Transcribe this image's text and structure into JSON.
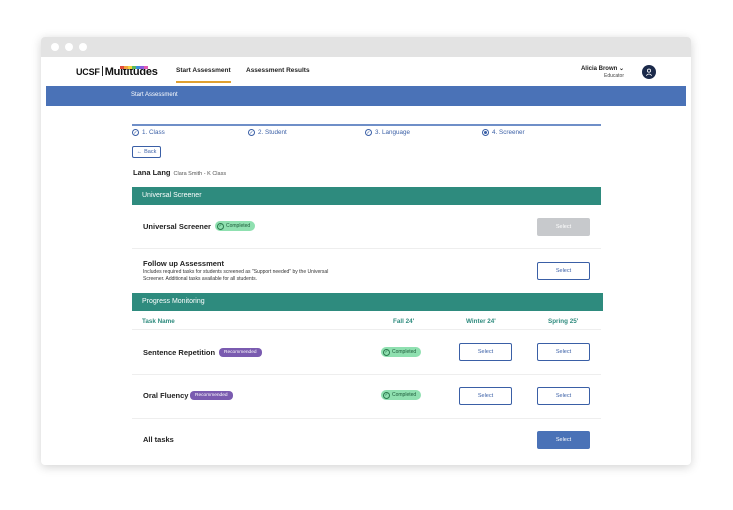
{
  "header": {
    "logo_prefix": "UCSF",
    "logo_name": "Multitudes",
    "tabs": [
      {
        "label": "Start Assessment",
        "active": true
      },
      {
        "label": "Assessment Results",
        "active": false
      }
    ],
    "user": {
      "name": "Alicia Brown",
      "role": "Educator",
      "icon": "user-icon"
    }
  },
  "banner": {
    "title": "Start Assessment"
  },
  "stepper": {
    "steps": [
      {
        "label": "1. Class",
        "state": "done"
      },
      {
        "label": "2. Student",
        "state": "done"
      },
      {
        "label": "3. Language",
        "state": "done"
      },
      {
        "label": "4. Screener",
        "state": "current"
      }
    ]
  },
  "back_label": "Back",
  "student": {
    "name": "Lana Lang",
    "class": "Clara Smith - K Class"
  },
  "universal": {
    "section_title": "Universal Screener",
    "row_title": "Universal Screener",
    "status": "Completed",
    "select_label": "Select"
  },
  "followup": {
    "title": "Follow up Assessment",
    "description": "Includes required tasks for students screened as \"Support needed\" by the Universal Screener. Additional tasks available for all students.",
    "select_label": "Select"
  },
  "progress": {
    "section_title": "Progress Monitoring",
    "columns": [
      "Task Name",
      "Fall 24'",
      "Winter 24'",
      "Spring 25'"
    ],
    "rows": [
      {
        "name": "Sentence Repetition",
        "tag": "Recommended",
        "fall": "Completed",
        "winter": "Select",
        "spring": "Select"
      },
      {
        "name": "Oral Fluency",
        "tag": "Recommended",
        "fall": "Completed",
        "winter": "Select",
        "spring": "Select"
      }
    ]
  },
  "all_tasks": {
    "label": "All tasks",
    "select_label": "Select"
  },
  "colors": {
    "primary": "#4a72b7",
    "teal": "#2e8b7e",
    "success": "#8fe0b0",
    "recommended": "#7a5bb0",
    "accent": "#e0a030"
  }
}
